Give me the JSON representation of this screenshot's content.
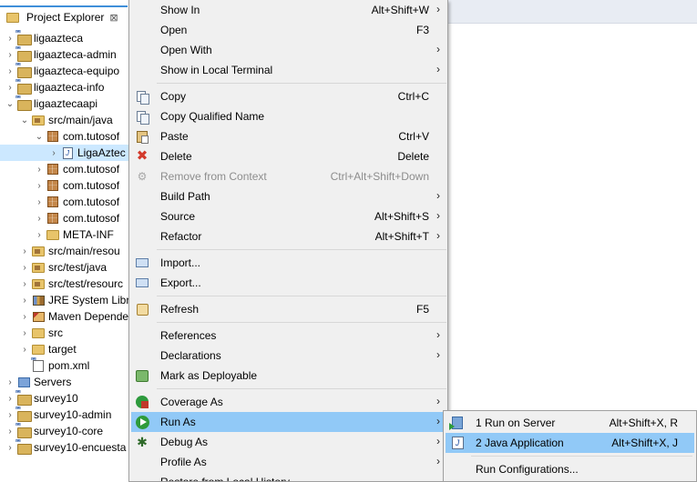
{
  "explorer": {
    "tab_label": "Project Explorer",
    "close_glyph": "⊠",
    "rows": [
      {
        "label": "ligaazteca",
        "depth": 0,
        "chevron": "›",
        "icon": "maven-project-icon"
      },
      {
        "label": "ligaazteca-admin",
        "depth": 0,
        "chevron": "›",
        "icon": "maven-project-icon"
      },
      {
        "label": "ligaazteca-equipo",
        "depth": 0,
        "chevron": "›",
        "icon": "maven-project-icon"
      },
      {
        "label": "ligaazteca-info",
        "depth": 0,
        "chevron": "›",
        "icon": "maven-project-icon"
      },
      {
        "label": "ligaaztecaapi",
        "depth": 0,
        "chevron": "⌄",
        "icon": "maven-project-icon"
      },
      {
        "label": "src/main/java",
        "depth": 1,
        "chevron": "⌄",
        "icon": "source-folder-icon"
      },
      {
        "label": "com.tutosof",
        "depth": 2,
        "chevron": "⌄",
        "icon": "package-icon"
      },
      {
        "label": "LigaAztec",
        "depth": 3,
        "chevron": "›",
        "icon": "java-file-icon",
        "selected": true
      },
      {
        "label": "com.tutosof",
        "depth": 2,
        "chevron": "›",
        "icon": "package-icon"
      },
      {
        "label": "com.tutosof",
        "depth": 2,
        "chevron": "›",
        "icon": "package-icon"
      },
      {
        "label": "com.tutosof",
        "depth": 2,
        "chevron": "›",
        "icon": "package-icon"
      },
      {
        "label": "com.tutosof",
        "depth": 2,
        "chevron": "›",
        "icon": "package-icon"
      },
      {
        "label": "META-INF",
        "depth": 2,
        "chevron": "›",
        "icon": "folder-icon"
      },
      {
        "label": "src/main/resou",
        "depth": 1,
        "chevron": "›",
        "icon": "source-folder-icon"
      },
      {
        "label": "src/test/java",
        "depth": 1,
        "chevron": "›",
        "icon": "source-folder-icon"
      },
      {
        "label": "src/test/resourc",
        "depth": 1,
        "chevron": "›",
        "icon": "source-folder-icon"
      },
      {
        "label": "JRE System Libr",
        "depth": 1,
        "chevron": "›",
        "icon": "library-icon"
      },
      {
        "label": "Maven Depende",
        "depth": 1,
        "chevron": "›",
        "icon": "maven-library-icon"
      },
      {
        "label": "src",
        "depth": 1,
        "chevron": "›",
        "icon": "folder-icon"
      },
      {
        "label": "target",
        "depth": 1,
        "chevron": "›",
        "icon": "folder-icon"
      },
      {
        "label": "pom.xml",
        "depth": 1,
        "chevron": "",
        "icon": "pom-file-icon"
      },
      {
        "label": "Servers",
        "depth": 0,
        "chevron": "›",
        "icon": "servers-folder-icon"
      },
      {
        "label": "survey10",
        "depth": 0,
        "chevron": "›",
        "icon": "maven-project-icon"
      },
      {
        "label": "survey10-admin",
        "depth": 0,
        "chevron": "›",
        "icon": "maven-project-icon"
      },
      {
        "label": "survey10-core",
        "depth": 0,
        "chevron": "›",
        "icon": "maven-project-icon"
      },
      {
        "label": "survey10-encuesta",
        "depth": 0,
        "chevron": "›",
        "icon": "maven-project-icon"
      }
    ]
  },
  "context_menu": {
    "items": [
      {
        "label": "Show In",
        "shortcut": "Alt+Shift+W",
        "submenu": true,
        "icon": ""
      },
      {
        "label": "Open",
        "shortcut": "F3",
        "submenu": false,
        "icon": ""
      },
      {
        "label": "Open With",
        "shortcut": "",
        "submenu": true,
        "icon": ""
      },
      {
        "label": "Show in Local Terminal",
        "shortcut": "",
        "submenu": true,
        "icon": ""
      },
      {
        "separator": true
      },
      {
        "label": "Copy",
        "shortcut": "Ctrl+C",
        "submenu": false,
        "icon": "copy-icon"
      },
      {
        "label": "Copy Qualified Name",
        "shortcut": "",
        "submenu": false,
        "icon": "copy-qualified-name-icon"
      },
      {
        "label": "Paste",
        "shortcut": "Ctrl+V",
        "submenu": false,
        "icon": "paste-icon"
      },
      {
        "label": "Delete",
        "shortcut": "Delete",
        "submenu": false,
        "icon": "delete-icon"
      },
      {
        "label": "Remove from Context",
        "shortcut": "Ctrl+Alt+Shift+Down",
        "submenu": false,
        "icon": "remove-from-context-icon",
        "disabled": true
      },
      {
        "label": "Build Path",
        "shortcut": "",
        "submenu": true,
        "icon": ""
      },
      {
        "label": "Source",
        "shortcut": "Alt+Shift+S",
        "submenu": true,
        "icon": ""
      },
      {
        "label": "Refactor",
        "shortcut": "Alt+Shift+T",
        "submenu": true,
        "icon": ""
      },
      {
        "separator": true
      },
      {
        "label": "Import...",
        "shortcut": "",
        "submenu": false,
        "icon": "import-icon"
      },
      {
        "label": "Export...",
        "shortcut": "",
        "submenu": false,
        "icon": "export-icon"
      },
      {
        "separator": true
      },
      {
        "label": "Refresh",
        "shortcut": "F5",
        "submenu": false,
        "icon": "refresh-icon"
      },
      {
        "separator": true
      },
      {
        "label": "References",
        "shortcut": "",
        "submenu": true,
        "icon": ""
      },
      {
        "label": "Declarations",
        "shortcut": "",
        "submenu": true,
        "icon": ""
      },
      {
        "label": "Mark as Deployable",
        "shortcut": "",
        "submenu": false,
        "icon": "deployable-icon"
      },
      {
        "separator": true
      },
      {
        "label": "Coverage As",
        "shortcut": "",
        "submenu": true,
        "icon": "coverage-icon"
      },
      {
        "label": "Run As",
        "shortcut": "",
        "submenu": true,
        "icon": "run-icon",
        "highlighted": true
      },
      {
        "label": "Debug As",
        "shortcut": "",
        "submenu": true,
        "icon": "debug-icon"
      },
      {
        "label": "Profile As",
        "shortcut": "",
        "submenu": true,
        "icon": ""
      },
      {
        "label": "Restore from Local History...",
        "shortcut": "",
        "submenu": false,
        "icon": ""
      }
    ]
  },
  "run_as_submenu": {
    "items": [
      {
        "label": "1 Run on Server",
        "shortcut": "Alt+Shift+X, R",
        "icon": "run-on-server-icon"
      },
      {
        "label": "2 Java Application",
        "shortcut": "Alt+Shift+X, J",
        "icon": "java-application-icon",
        "highlighted": true
      },
      {
        "separator": true
      },
      {
        "label": "Run Configurations...",
        "shortcut": "",
        "icon": ""
      }
    ]
  }
}
